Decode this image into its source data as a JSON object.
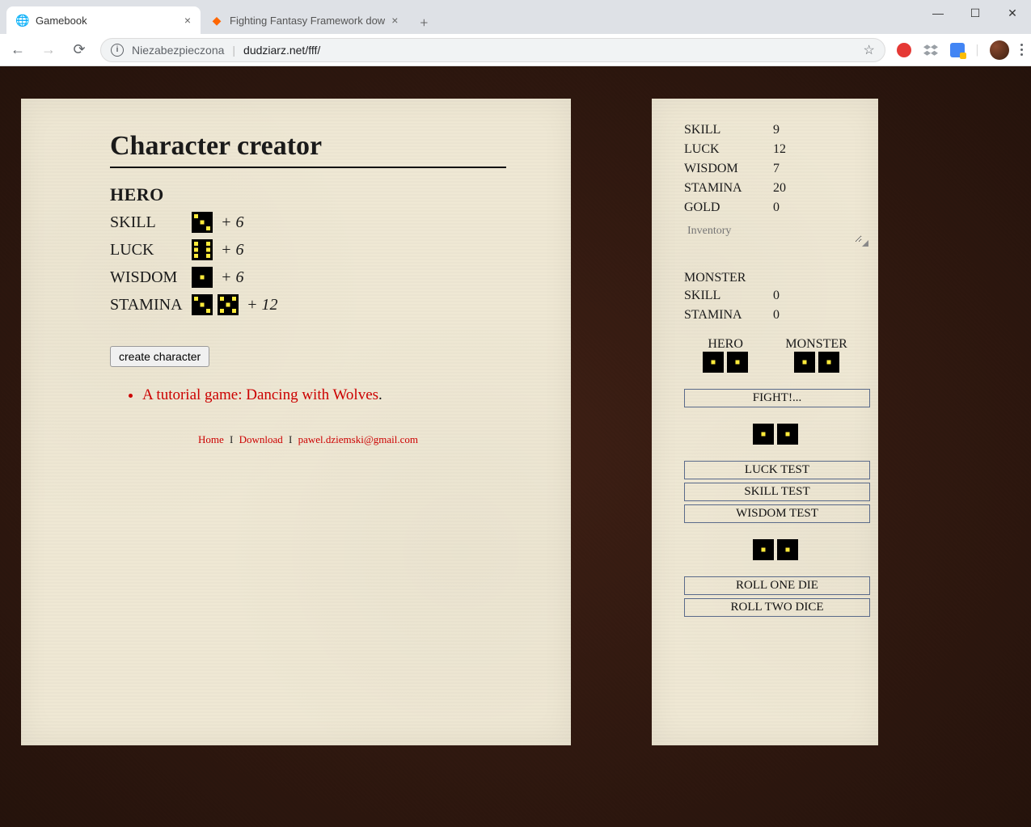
{
  "browser": {
    "tabs": [
      {
        "title": "Gamebook",
        "active": true
      },
      {
        "title": "Fighting Fantasy Framework dow",
        "active": false
      }
    ],
    "security_label": "Niezabezpieczona",
    "url": "dudziarz.net/fff/"
  },
  "creator": {
    "title": "Character creator",
    "hero_label": "HERO",
    "stats": {
      "skill": {
        "label": "SKILL",
        "bonus": "+ 6",
        "dice": [
          3
        ]
      },
      "luck": {
        "label": "LUCK",
        "bonus": "+ 6",
        "dice": [
          6
        ]
      },
      "wisdom": {
        "label": "WISDOM",
        "bonus": "+ 6",
        "dice": [
          1
        ]
      },
      "stamina": {
        "label": "STAMINA",
        "bonus": "+ 12",
        "dice": [
          3,
          5
        ]
      }
    },
    "create_button": "create character",
    "tutorial_link": "A tutorial game: Dancing with Wolves",
    "footer": {
      "home": "Home",
      "download": "Download",
      "email": "pawel.dziemski@gmail.com",
      "sep": "I"
    }
  },
  "sheet": {
    "stats": {
      "skill": {
        "label": "SKILL",
        "value": "9"
      },
      "luck": {
        "label": "LUCK",
        "value": "12"
      },
      "wisdom": {
        "label": "WISDOM",
        "value": "7"
      },
      "stamina": {
        "label": "STAMINA",
        "value": "20"
      },
      "gold": {
        "label": "GOLD",
        "value": "0"
      }
    },
    "inventory_placeholder": "Inventory",
    "monster": {
      "label": "MONSTER",
      "skill": {
        "label": "SKILL",
        "value": "0"
      },
      "stamina": {
        "label": "STAMINA",
        "value": "0"
      }
    },
    "combat": {
      "hero_label": "HERO",
      "monster_label": "MONSTER"
    },
    "buttons": {
      "fight": "FIGHT!...",
      "luck_test": "LUCK TEST",
      "skill_test": "SKILL TEST",
      "wisdom_test": "WISDOM TEST",
      "roll_one": "ROLL ONE DIE",
      "roll_two": "ROLL TWO DICE"
    }
  }
}
